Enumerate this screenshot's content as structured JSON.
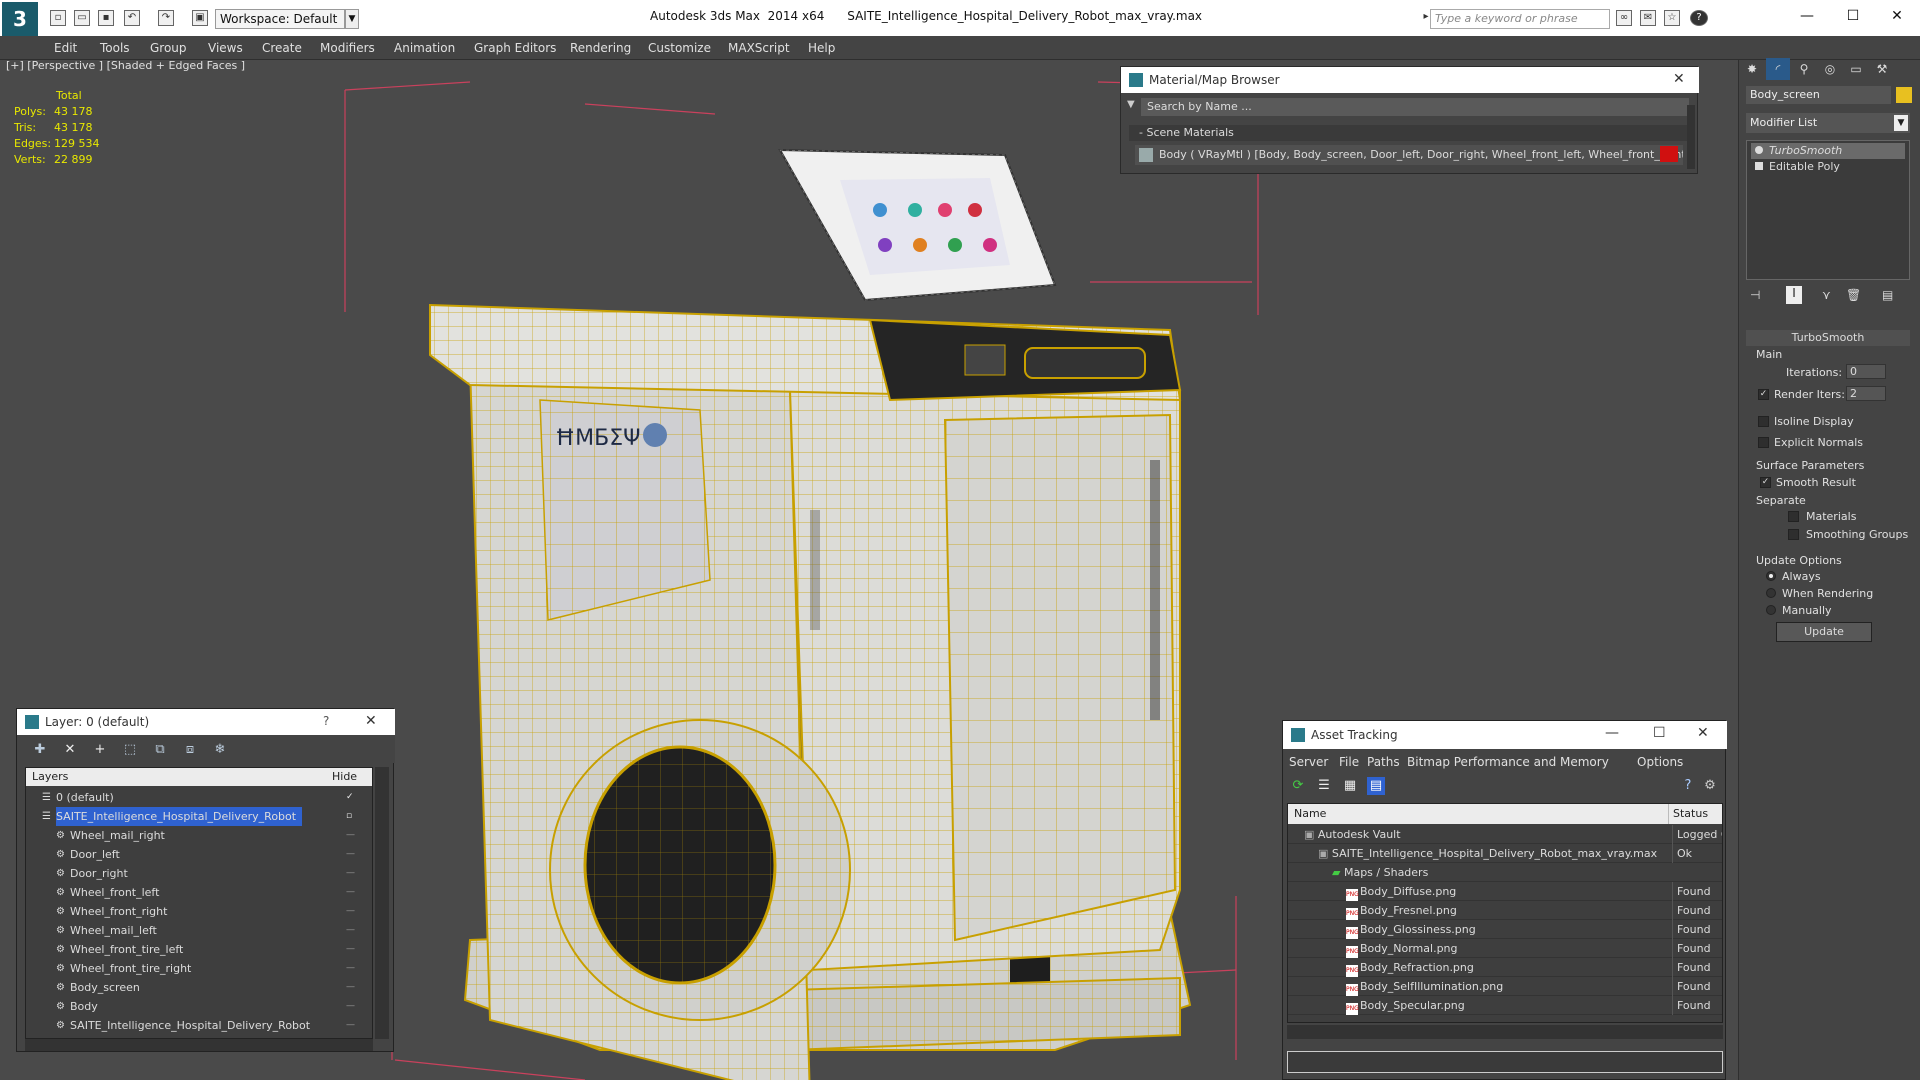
{
  "titlebar": {
    "workspace": "Workspace: Default",
    "app": "Autodesk 3ds Max  2014 x64",
    "file": "SAITE_Intelligence_Hospital_Delivery_Robot_max_vray.max",
    "search_placeholder": "Type a keyword or phrase",
    "help": "?"
  },
  "menu": [
    "Edit",
    "Tools",
    "Group",
    "Views",
    "Create",
    "Modifiers",
    "Animation",
    "Graph Editors",
    "Rendering",
    "Customize",
    "MAXScript",
    "Help"
  ],
  "viewport": {
    "label": "[+] [Perspective ] [Shaded + Edged Faces ]",
    "stats": {
      "header": "Total",
      "rows": [
        {
          "label": "Polys:",
          "value": "43 178"
        },
        {
          "label": "Tris:",
          "value": "43 178"
        },
        {
          "label": "Edges:",
          "value": "129 534"
        },
        {
          "label": "Verts:",
          "value": "22 899"
        }
      ]
    }
  },
  "material_browser": {
    "title": "Material/Map Browser",
    "search": "Search by Name ...",
    "section": "- Scene Materials",
    "row": "Body ( VRayMtl ) [Body, Body_screen, Door_left, Door_right, Wheel_front_left, Wheel_front_right,..."
  },
  "command_panel": {
    "object_name": "Body_screen",
    "modifier_list": "Modifier List",
    "stack": [
      "TurboSmooth",
      "Editable Poly"
    ],
    "rollout": "TurboSmooth",
    "main": "Main",
    "iterations_label": "Iterations:",
    "iterations": "0",
    "render_iters_label": "Render Iters:",
    "render_iters": "2",
    "isoline": "Isoline Display",
    "explicit_normals": "Explicit Normals",
    "surface_params": "Surface Parameters",
    "smooth_result": "Smooth Result",
    "separate": "Separate",
    "materials": "Materials",
    "smoothing_groups": "Smoothing Groups",
    "update_options": "Update Options",
    "always": "Always",
    "when_rendering": "When Rendering",
    "manually": "Manually",
    "update": "Update"
  },
  "layer_panel": {
    "title": "Layer: 0 (default)",
    "help": "?",
    "col_layers": "Layers",
    "col_hide": "Hide",
    "rows": [
      {
        "name": "0 (default)",
        "level": 0
      },
      {
        "name": "SAITE_Intelligence_Hospital_Delivery_Robot",
        "level": 0
      },
      {
        "name": "Wheel_mail_right",
        "level": 1
      },
      {
        "name": "Door_left",
        "level": 1
      },
      {
        "name": "Door_right",
        "level": 1
      },
      {
        "name": "Wheel_front_left",
        "level": 1
      },
      {
        "name": "Wheel_front_right",
        "level": 1
      },
      {
        "name": "Wheel_mail_left",
        "level": 1
      },
      {
        "name": "Wheel_front_tire_left",
        "level": 1
      },
      {
        "name": "Wheel_front_tire_right",
        "level": 1
      },
      {
        "name": "Body_screen",
        "level": 1
      },
      {
        "name": "Body",
        "level": 1
      },
      {
        "name": "SAITE_Intelligence_Hospital_Delivery_Robot",
        "level": 1
      }
    ]
  },
  "asset_tracking": {
    "title": "Asset Tracking",
    "menu": [
      "Server",
      "File",
      "Paths",
      "Bitmap Performance and Memory",
      "Options"
    ],
    "col_name": "Name",
    "col_status": "Status",
    "rows": [
      {
        "name": "Autodesk Vault",
        "status": "Logged O",
        "level": 0
      },
      {
        "name": "SAITE_Intelligence_Hospital_Delivery_Robot_max_vray.max",
        "status": "Ok",
        "level": 1
      },
      {
        "name": "Maps / Shaders",
        "status": "",
        "level": 2
      },
      {
        "name": "Body_Diffuse.png",
        "status": "Found",
        "level": 3
      },
      {
        "name": "Body_Fresnel.png",
        "status": "Found",
        "level": 3
      },
      {
        "name": "Body_Glossiness.png",
        "status": "Found",
        "level": 3
      },
      {
        "name": "Body_Normal.png",
        "status": "Found",
        "level": 3
      },
      {
        "name": "Body_Refraction.png",
        "status": "Found",
        "level": 3
      },
      {
        "name": "Body_SelfIllumination.png",
        "status": "Found",
        "level": 3
      },
      {
        "name": "Body_Specular.png",
        "status": "Found",
        "level": 3
      }
    ]
  },
  "colors": {
    "wire": "#c8a000",
    "body": "#d8d8d4",
    "selection": "#2f62d0",
    "stats": "#e8e800"
  }
}
